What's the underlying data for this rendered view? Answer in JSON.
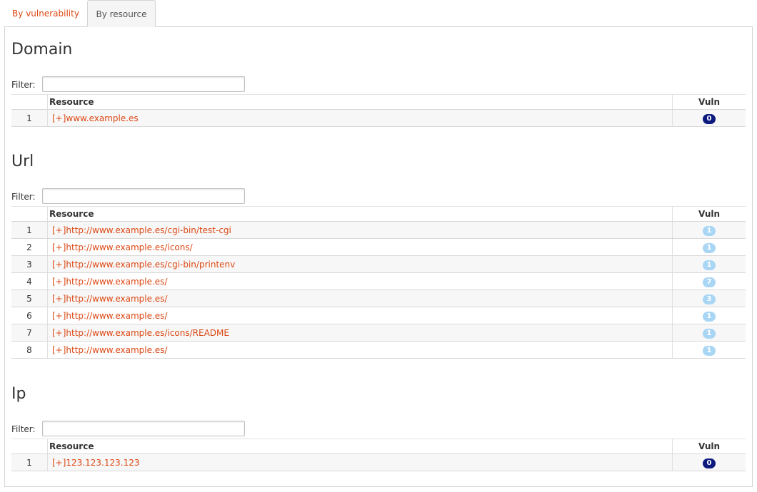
{
  "tabs": [
    {
      "label": "By vulnerability",
      "active": false
    },
    {
      "label": "By resource",
      "active": true
    }
  ],
  "colors": {
    "accent": "#dd4814",
    "badge_zero": "#0d1b7e",
    "badge_low": "#a9d6f5"
  },
  "table_headers": {
    "resource": "Resource",
    "vuln": "Vuln"
  },
  "filter_label": "Filter:",
  "sections": {
    "domain": {
      "title": "Domain",
      "filter_value": "",
      "rows": [
        {
          "num": "1",
          "resource": "[+]www.example.es",
          "vuln": "0"
        }
      ]
    },
    "url": {
      "title": "Url",
      "filter_value": "",
      "rows": [
        {
          "num": "1",
          "resource": "[+]http://www.example.es/cgi-bin/test-cgi",
          "vuln": "1"
        },
        {
          "num": "2",
          "resource": "[+]http://www.example.es/icons/",
          "vuln": "1"
        },
        {
          "num": "3",
          "resource": "[+]http://www.example.es/cgi-bin/printenv",
          "vuln": "1"
        },
        {
          "num": "4",
          "resource": "[+]http://www.example.es/",
          "vuln": "7"
        },
        {
          "num": "5",
          "resource": "[+]http://www.example.es/",
          "vuln": "3"
        },
        {
          "num": "6",
          "resource": "[+]http://www.example.es/",
          "vuln": "1"
        },
        {
          "num": "7",
          "resource": "[+]http://www.example.es/icons/README",
          "vuln": "1"
        },
        {
          "num": "8",
          "resource": "[+]http://www.example.es/",
          "vuln": "1"
        }
      ]
    },
    "ip": {
      "title": "Ip",
      "filter_value": "",
      "rows": [
        {
          "num": "1",
          "resource": "[+]123.123.123.123",
          "vuln": "0"
        }
      ]
    }
  }
}
